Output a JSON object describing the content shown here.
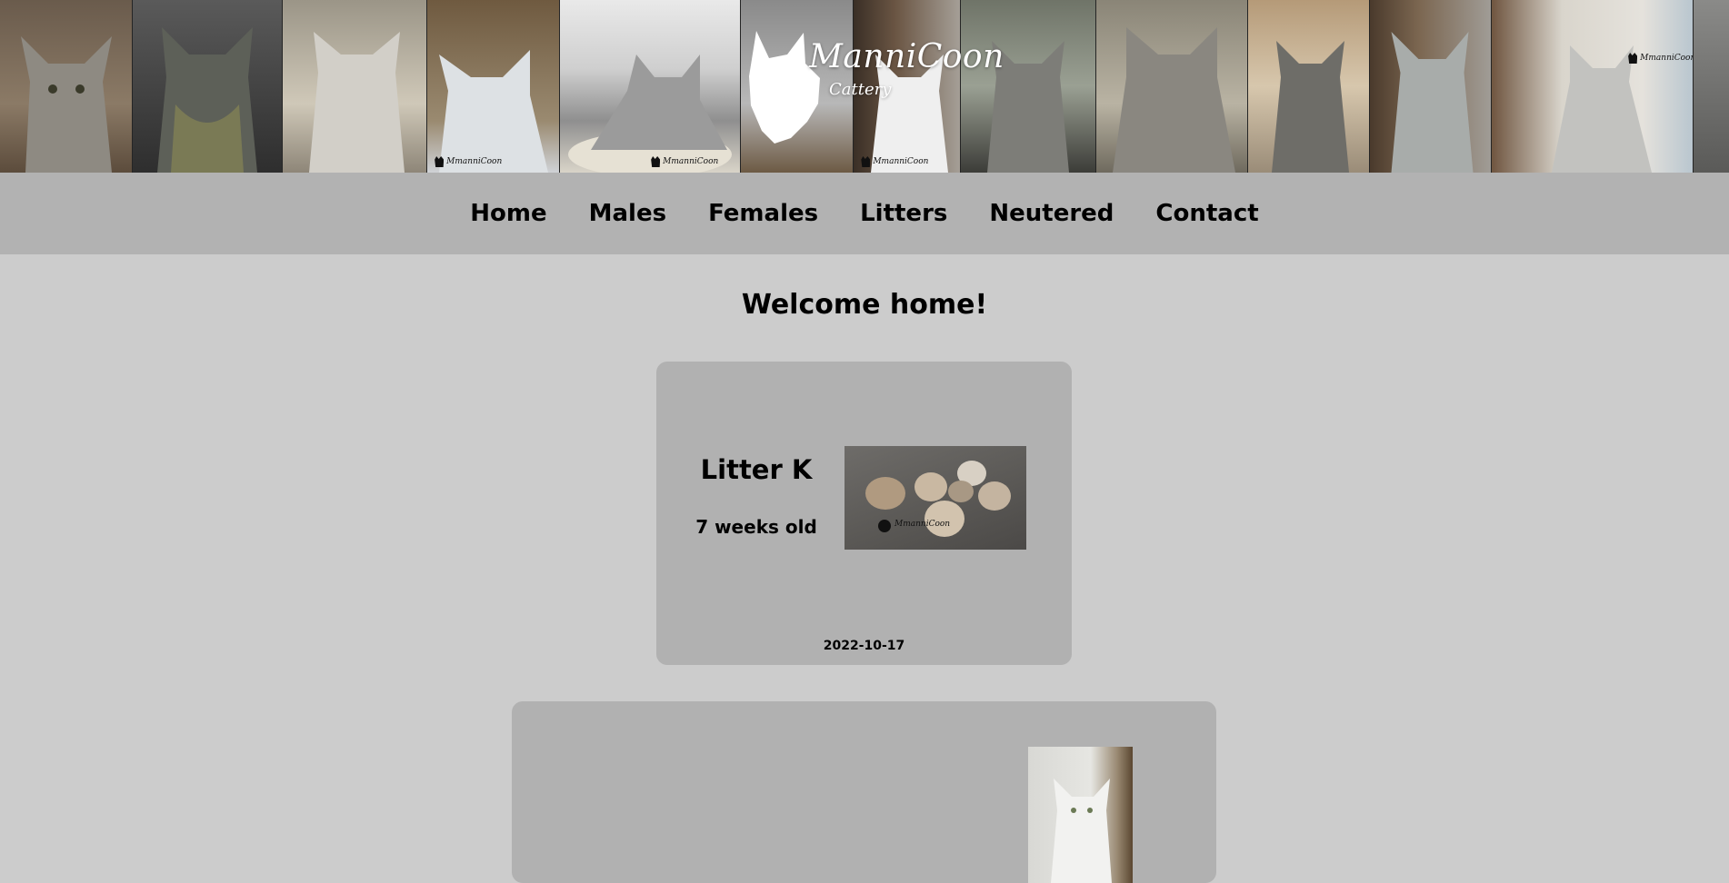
{
  "brand": {
    "name": "ManniCoon",
    "subtitle": "Cattery",
    "watermark": "MmanniCoon"
  },
  "nav": {
    "items": [
      "Home",
      "Males",
      "Females",
      "Litters",
      "Neutered",
      "Contact"
    ]
  },
  "page": {
    "heading": "Welcome home!"
  },
  "posts": [
    {
      "title": "Litter K",
      "subtitle": "7 weeks old",
      "date": "2022-10-17",
      "image": "kittens-photo"
    },
    {
      "image": "white-cat-photo"
    }
  ],
  "colors": {
    "page_bg": "#cccccc",
    "nav_bg": "#b2b2b2",
    "card_bg": "#b1b1b1"
  }
}
